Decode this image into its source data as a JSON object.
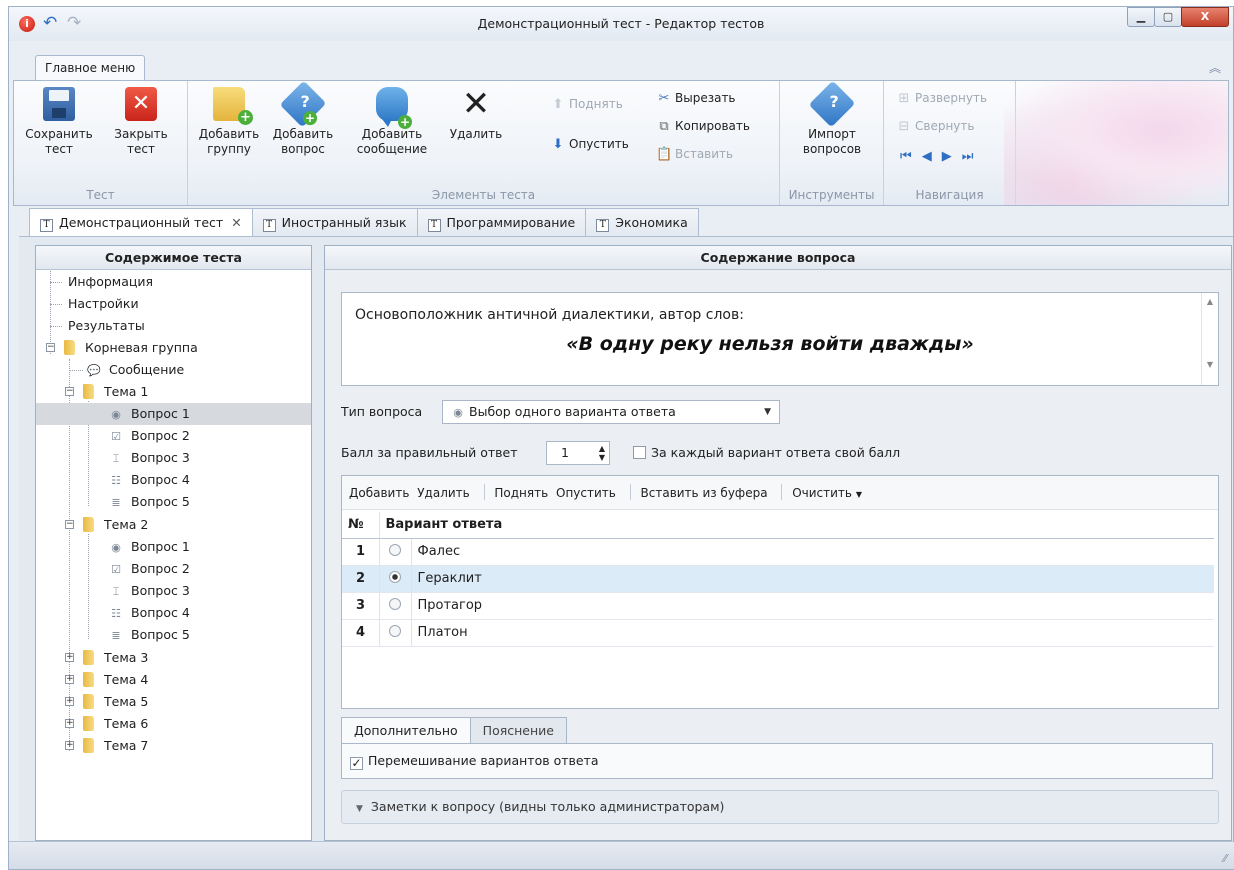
{
  "window": {
    "title": "Демонстрационный тест - Редактор тестов",
    "logo": "i"
  },
  "ribbon": {
    "tab": "Главное меню",
    "groups": {
      "test": "Тест",
      "elements": "Элементы теста",
      "tools": "Инструменты",
      "navigation": "Навигация"
    },
    "save": [
      "Сохранить",
      "тест"
    ],
    "close": [
      "Закрыть",
      "тест"
    ],
    "add_group": [
      "Добавить",
      "группу"
    ],
    "add_question": [
      "Добавить",
      "вопрос"
    ],
    "add_message": [
      "Добавить",
      "сообщение"
    ],
    "delete": "Удалить",
    "move_up": "Поднять",
    "move_down": "Опустить",
    "cut": "Вырезать",
    "copy": "Копировать",
    "paste": "Вставить",
    "import": [
      "Импорт",
      "вопросов"
    ],
    "expand": "Развернуть",
    "collapse": "Свернуть"
  },
  "doc_tabs": [
    {
      "label": "Демонстрационный тест",
      "active": true
    },
    {
      "label": "Иностранный язык"
    },
    {
      "label": "Программирование"
    },
    {
      "label": "Экономика"
    }
  ],
  "left_panel": {
    "title": "Содержимое теста",
    "info": "Информация",
    "settings": "Настройки",
    "results": "Результаты",
    "root": "Корневая группа",
    "message": "Сообщение",
    "topics": [
      "Тема 1",
      "Тема 2",
      "Тема 3",
      "Тема 4",
      "Тема 5",
      "Тема 6",
      "Тема 7"
    ],
    "questions": [
      "Вопрос 1",
      "Вопрос 2",
      "Вопрос 3",
      "Вопрос 4",
      "Вопрос 5"
    ]
  },
  "right_panel": {
    "title": "Содержание вопроса",
    "question_line1": "Основоположник античной диалектики, автор слов:",
    "question_line2": "«В одну реку нельзя войти дважды»",
    "type_label": "Тип вопроса",
    "type_value": "Выбор одного варианта ответа",
    "score_label": "Балл за правильный ответ",
    "score_value": "1",
    "each_score_label": "За каждый вариант ответа свой балл",
    "toolbar": {
      "add": "Добавить",
      "delete": "Удалить",
      "up": "Поднять",
      "down": "Опустить",
      "paste": "Вставить из буфера",
      "clear": "Очистить"
    },
    "columns": [
      "№",
      "Вариант ответа"
    ],
    "answers": [
      {
        "n": "1",
        "text": "Фалес",
        "selected": false
      },
      {
        "n": "2",
        "text": "Гераклит",
        "selected": true
      },
      {
        "n": "3",
        "text": "Протагор",
        "selected": false
      },
      {
        "n": "4",
        "text": "Платон",
        "selected": false
      }
    ],
    "sub_tabs": [
      "Дополнительно",
      "Пояснение"
    ],
    "shuffle_label": "Перемешивание вариантов ответа",
    "notes_label": "Заметки к вопросу (видны только администраторам)"
  },
  "colors": {
    "accent": "#2f6fc3",
    "selected_row": "#dcebf8",
    "close_button": "#c9241a"
  }
}
